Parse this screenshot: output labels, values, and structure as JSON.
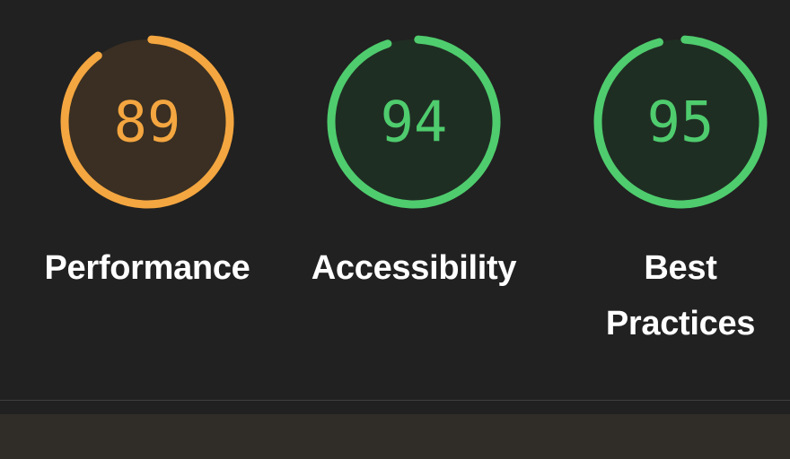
{
  "scores": [
    {
      "value": "89",
      "label": "Performance",
      "score_fraction": 0.89,
      "status": "average",
      "color": "#f4a640",
      "fill": "#3a2f22"
    },
    {
      "value": "94",
      "label": "Accessibility",
      "score_fraction": 0.94,
      "status": "pass",
      "color": "#4fcc6e",
      "fill": "#1f2e23"
    },
    {
      "value": "95",
      "label": "Best Practices",
      "score_fraction": 0.95,
      "status": "pass",
      "color": "#4fcc6e",
      "fill": "#1f2e23"
    }
  ]
}
